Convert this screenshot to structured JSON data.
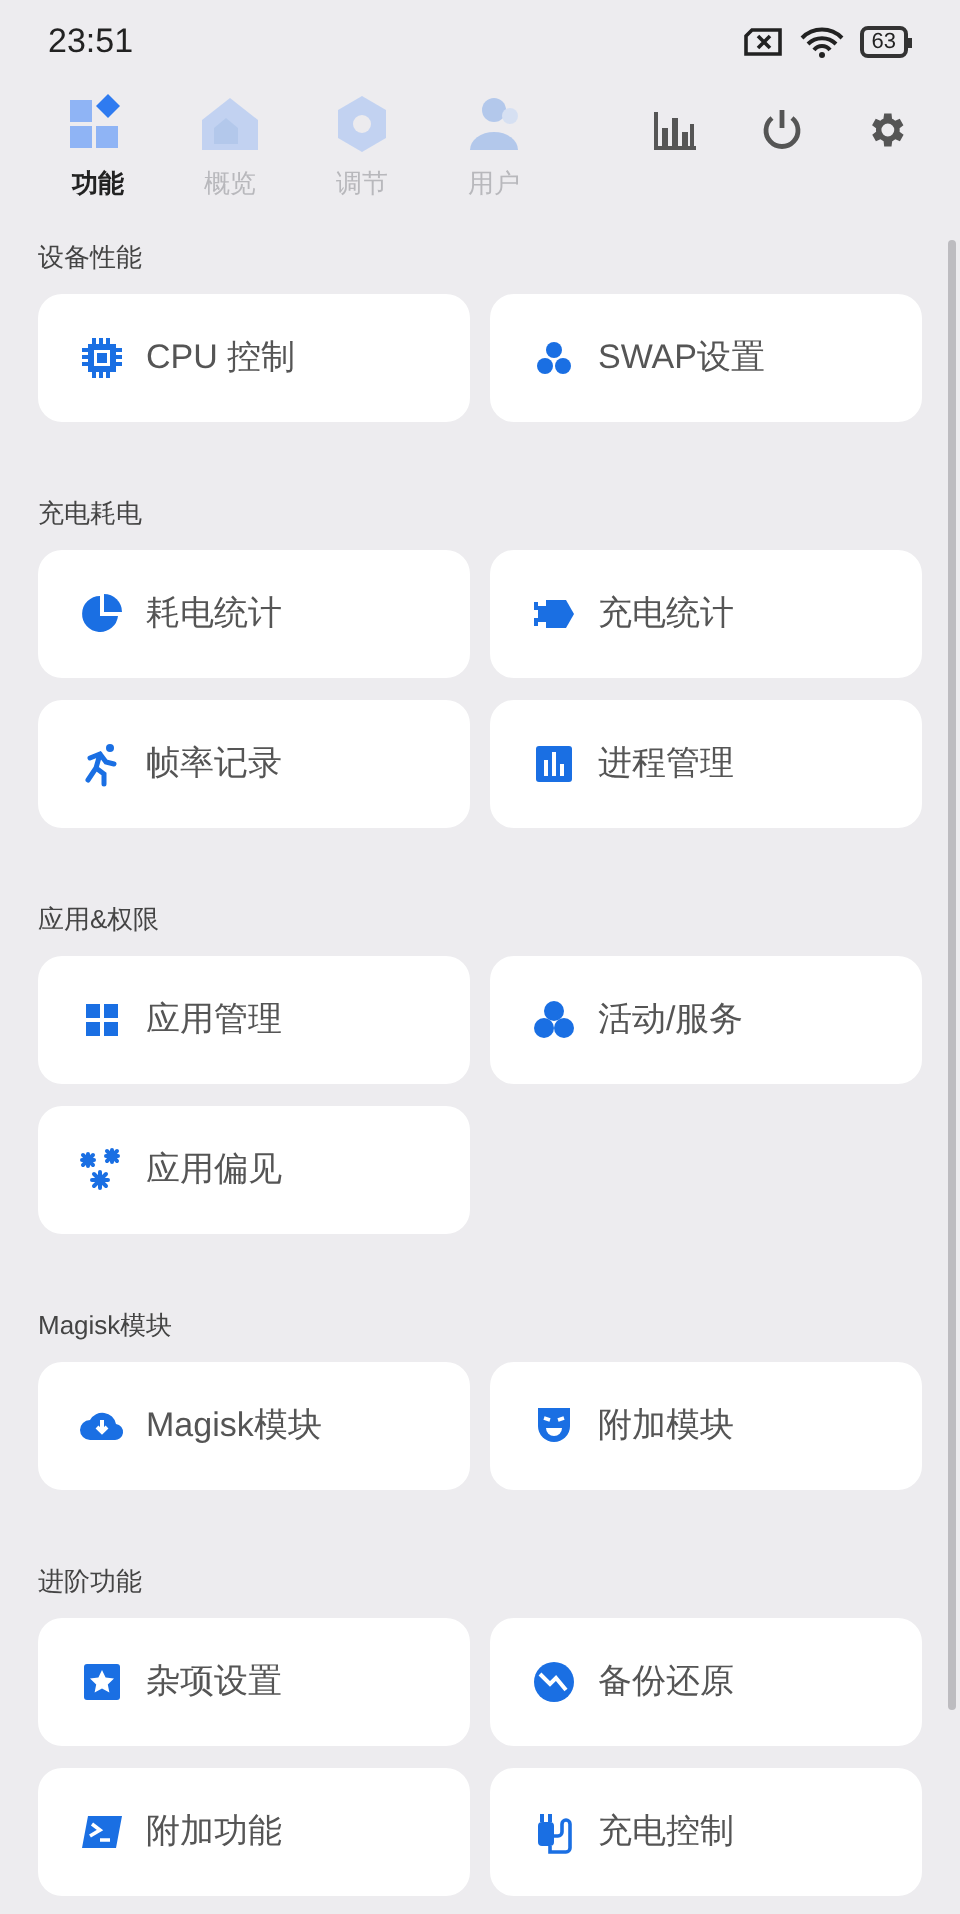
{
  "status_bar": {
    "time": "23:51",
    "battery": "63"
  },
  "tabs": [
    {
      "label": "功能",
      "selected": true
    },
    {
      "label": "概览",
      "selected": false
    },
    {
      "label": "调节",
      "selected": false
    },
    {
      "label": "用户",
      "selected": false
    }
  ],
  "sections": [
    {
      "title": "设备性能",
      "items": [
        "CPU 控制",
        "SWAP设置"
      ]
    },
    {
      "title": "充电耗电",
      "items": [
        "耗电统计",
        "充电统计",
        "帧率记录",
        "进程管理"
      ]
    },
    {
      "title": "应用&权限",
      "items": [
        "应用管理",
        "活动/服务",
        "应用偏见"
      ]
    },
    {
      "title": "Magisk模块",
      "items": [
        "Magisk模块",
        "附加模块"
      ]
    },
    {
      "title": "进阶功能",
      "items": [
        "杂项设置",
        "备份还原",
        "附加功能",
        "充电控制"
      ]
    }
  ]
}
